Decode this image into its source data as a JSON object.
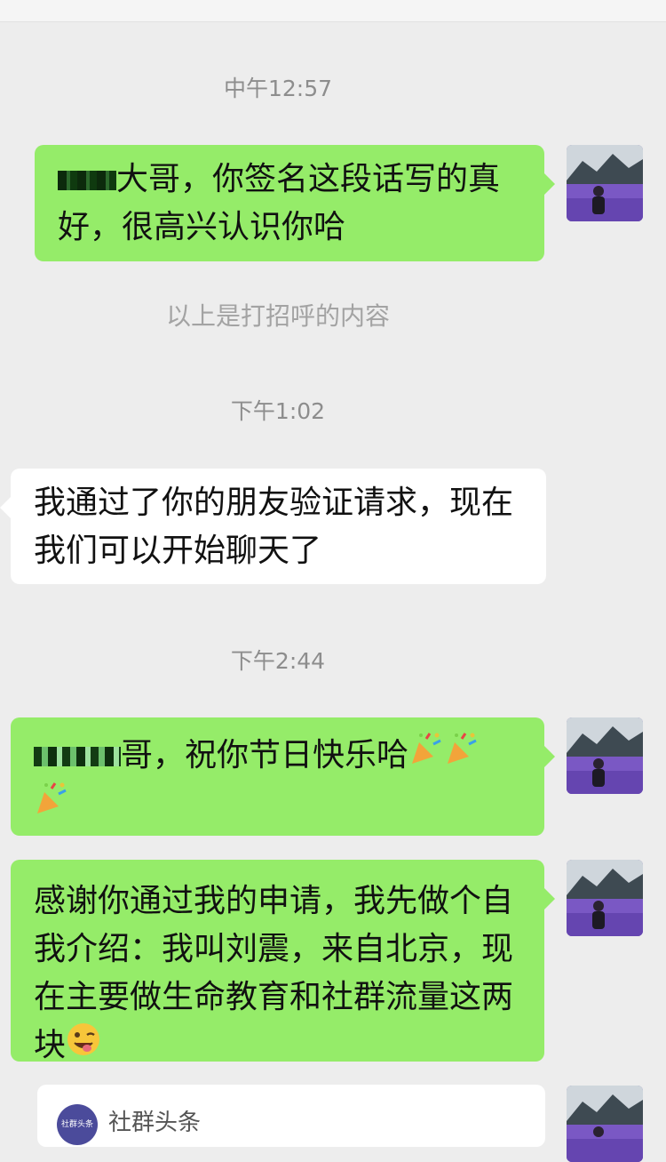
{
  "timestamps": [
    "中午12:57",
    "下午1:02",
    "下午2:44"
  ],
  "system_notice": "以上是打招呼的内容",
  "messages": [
    {
      "line1": "大哥，你签名这段话写的真",
      "line2": "好，很高兴认识你哈"
    },
    {
      "line1": "我通过了你的朋友验证请求，现在",
      "line2": "我们可以开始聊天了"
    },
    {
      "text": "哥，祝你节日快乐哈"
    },
    {
      "line1": "感谢你通过我的申请，我先做个自",
      "line2": "我介绍：我叫刘震，来自北京，现",
      "line3": "在主要做生命教育和社群流量这两",
      "line4": "块"
    }
  ],
  "card": {
    "logo_text": "社群头条",
    "name": "社群头条"
  },
  "icons": {
    "avatar": "avatar-lavender-field",
    "party": "party-popper-icon",
    "wink": "winking-tongue-face-icon"
  },
  "colors": {
    "sent_bubble": "#95ec69",
    "received_bubble": "#ffffff",
    "background": "#ededed"
  }
}
